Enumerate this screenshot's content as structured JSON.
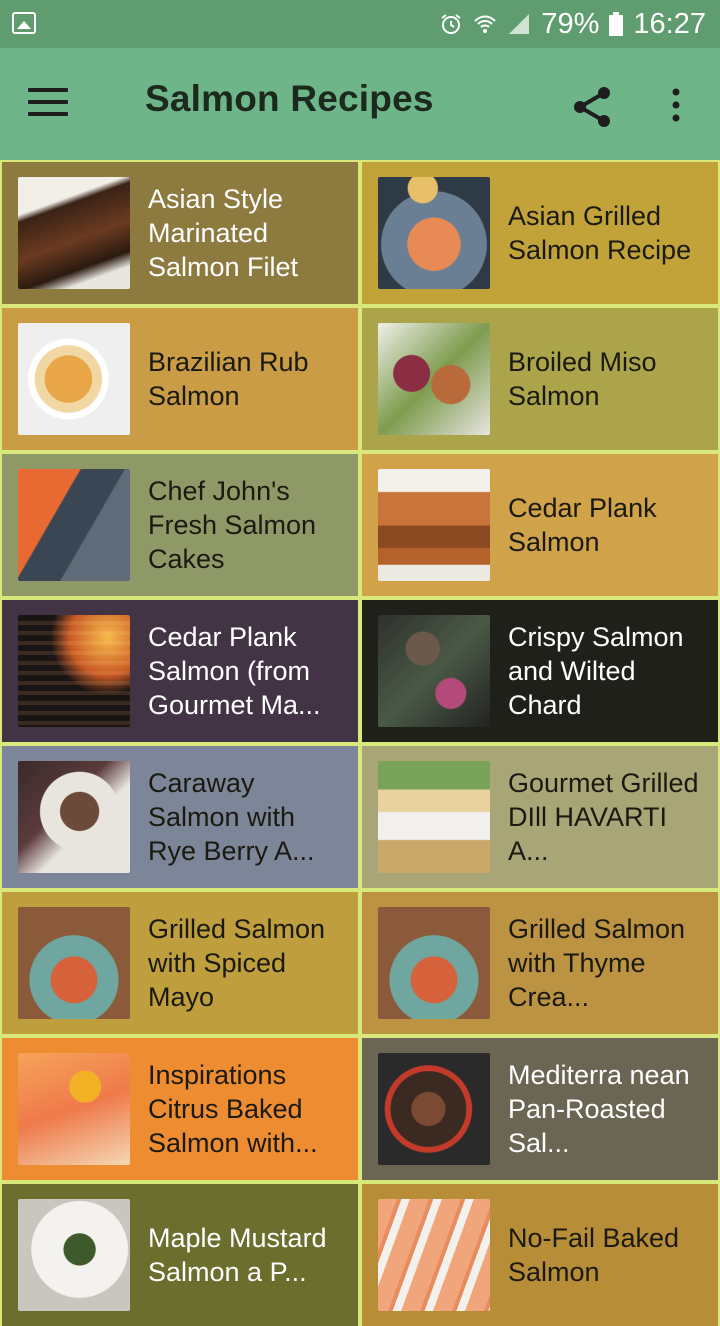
{
  "status": {
    "battery": "79%",
    "time": "16:27"
  },
  "app_bar": {
    "title": "Salmon Recipes"
  },
  "recipes": [
    {
      "title": "Asian Style Marinated Salmon Filet",
      "bg": "#8c7a3f",
      "text_color": "#ffffff"
    },
    {
      "title": "Asian Grilled Salmon Recipe",
      "bg": "#c2a339",
      "text_color": "#1a1a10"
    },
    {
      "title": "Brazilian Rub Salmon",
      "bg": "#c99c45",
      "text_color": "#1a1a10"
    },
    {
      "title": "Broiled Miso Salmon",
      "bg": "#aba44a",
      "text_color": "#1a1a10"
    },
    {
      "title": "Chef John's Fresh Salmon Cakes",
      "bg": "#8f9967",
      "text_color": "#1a1a10"
    },
    {
      "title": "Cedar Plank Salmon",
      "bg": "#d0a34a",
      "text_color": "#1a1a10"
    },
    {
      "title": "Cedar Plank Salmon (from Gourmet Ma...",
      "bg": "#433445",
      "text_color": "#ffffff"
    },
    {
      "title": "Crispy Salmon and Wilted Chard",
      "bg": "#20201a",
      "text_color": "#ffffff"
    },
    {
      "title": "Caraway Salmon with Rye Berry A...",
      "bg": "#7d8598",
      "text_color": "#1a1a10"
    },
    {
      "title": "Gourmet Grilled DIll HAVARTI A...",
      "bg": "#a8a577",
      "text_color": "#1a1a10"
    },
    {
      "title": "Grilled Salmon with Spiced Mayo",
      "bg": "#bf9e3e",
      "text_color": "#1a1a10"
    },
    {
      "title": "Grilled Salmon with Thyme Crea...",
      "bg": "#bb9342",
      "text_color": "#1a1a10"
    },
    {
      "title": "Inspirations Citrus Baked Salmon with...",
      "bg": "#ee8c31",
      "text_color": "#1a1a10"
    },
    {
      "title": "Mediterra nean Pan-Roasted Sal...",
      "bg": "#6b6553",
      "text_color": "#ffffff"
    },
    {
      "title": "Maple Mustard Salmon a P...",
      "bg": "#6c6e2e",
      "text_color": "#ffffff"
    },
    {
      "title": "No-Fail Baked Salmon",
      "bg": "#b88d38",
      "text_color": "#1a1a10"
    }
  ]
}
